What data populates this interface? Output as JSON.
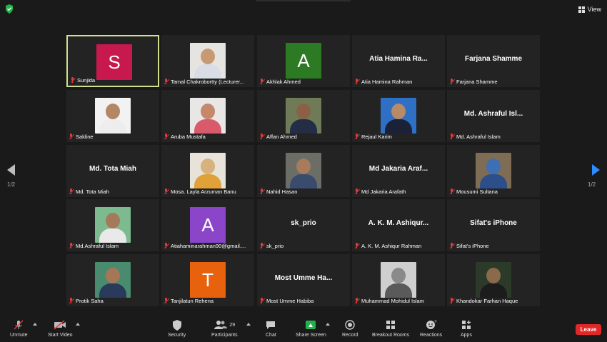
{
  "top": {
    "view_label": "View"
  },
  "pages": {
    "left": "1/2",
    "right": "1/2"
  },
  "participants": [
    {
      "name": "Sunjida",
      "type": "avatar",
      "initial": "S",
      "color": "#c8194f",
      "active": true
    },
    {
      "name": "Tamal Chakrobortty (Lecturer...",
      "type": "photo",
      "bg": "#e6e4e0",
      "head": "#c79a74",
      "body": "#d8dde6"
    },
    {
      "name": "Akhlak Ahmed",
      "type": "avatar",
      "initial": "A",
      "color": "#2c7a23"
    },
    {
      "name": "Atia Hamina Rahman",
      "type": "text",
      "display": "Atia Hamina Ra..."
    },
    {
      "name": "Farjana Shamme",
      "type": "text",
      "display": "Farjana Shamme"
    },
    {
      "name": "Sakline",
      "type": "photo",
      "bg": "#f2f2f2",
      "head": "#b58664",
      "body": "#ededed"
    },
    {
      "name": "Aruba Mustafa",
      "type": "photo",
      "bg": "#e9e7e5",
      "head": "#c6876b",
      "body": "#d95a6a"
    },
    {
      "name": "Affan Ahmed",
      "type": "photo",
      "bg": "#6f7b56",
      "head": "#8a6046",
      "body": "#232d45"
    },
    {
      "name": "Rejaul Karim",
      "type": "photo",
      "bg": "#2f6fc4",
      "head": "#b98a66",
      "body": "#1b2238"
    },
    {
      "name": "Md. Ashraful Islam",
      "type": "text",
      "display": "Md. Ashraful Isl..."
    },
    {
      "name": "Md. Tota Miah",
      "type": "text",
      "display": "Md. Tota Miah"
    },
    {
      "name": "Mosa. Layla Arzuman Banu",
      "type": "photo",
      "bg": "#e7e3d8",
      "head": "#d7b17e",
      "body": "#e0a238"
    },
    {
      "name": "Nahid Hasan",
      "type": "photo",
      "bg": "#6d6d68",
      "head": "#a77b5b",
      "body": "#3a4c6d"
    },
    {
      "name": "Md Jakaria Arafath",
      "type": "text",
      "display": "Md Jakaria Araf..."
    },
    {
      "name": "Mousumi Sultana",
      "type": "photo",
      "bg": "#7e6c55",
      "head": "#3c6fb4",
      "body": "#2c4f8b"
    },
    {
      "name": "Md.Ashraful Islam",
      "type": "photo",
      "bg": "#7dba90",
      "head": "#a57a5a",
      "body": "#e9e9e9"
    },
    {
      "name": "Atiahaminarahman90@gmail....",
      "type": "avatar",
      "initial": "A",
      "color": "#8a45c8"
    },
    {
      "name": "sk_prio",
      "type": "text",
      "display": "sk_prio"
    },
    {
      "name": "A. K. M. Ashiqur Rahman",
      "type": "text",
      "display": "A. K. M. Ashiqur..."
    },
    {
      "name": "Sifat's iPhone",
      "type": "text",
      "display": "Sifat's iPhone"
    },
    {
      "name": "Protik Saha",
      "type": "photo",
      "bg": "#4a8a6e",
      "head": "#a57757",
      "body": "#2a3a5a"
    },
    {
      "name": "Tanjilatun Rehena",
      "type": "avatar",
      "initial": "T",
      "color": "#e8620e"
    },
    {
      "name": "Most Umme Habiba",
      "type": "text",
      "display": "Most Umme Ha..."
    },
    {
      "name": "Muhammad Mohidul Islam",
      "type": "photo",
      "bg": "#cfcfcf",
      "head": "#8a8a8a",
      "body": "#5a5a5a"
    },
    {
      "name": "Khandokar Farhan Haque",
      "type": "photo",
      "bg": "#2c3a2a",
      "head": "#8a6a4a",
      "body": "#1c1c1c"
    }
  ],
  "toolbar": {
    "unmute": "Unmute",
    "start_video": "Start Video",
    "security": "Security",
    "participants": "Participants",
    "participants_count": "29",
    "chat": "Chat",
    "share_screen": "Share Screen",
    "record": "Record",
    "breakout_rooms": "Breakout Rooms",
    "reactions": "Reactions",
    "apps": "Apps",
    "leave": "Leave"
  }
}
